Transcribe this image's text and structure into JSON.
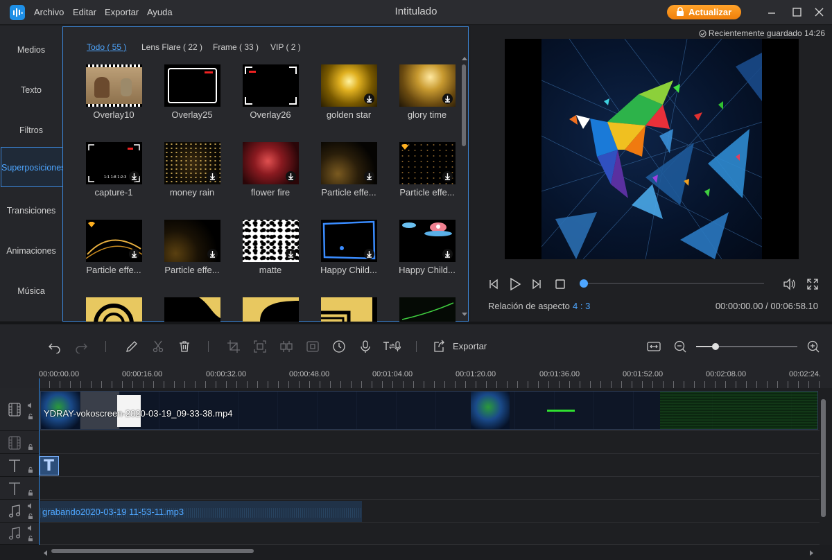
{
  "titlebar": {
    "menu": [
      "Archivo",
      "Editar",
      "Exportar",
      "Ayuda"
    ],
    "title": "Intitulado",
    "upgrade_label": "Actualizar"
  },
  "nav": {
    "items": [
      "Medios",
      "Texto",
      "Filtros",
      "Superposiciones",
      "Transiciones",
      "Animaciones",
      "Música"
    ],
    "active": "Superposiciones"
  },
  "media": {
    "tabs": [
      "Todo ( 55 )",
      "Lens Flare ( 22 )",
      "Frame ( 33 )",
      "VIP ( 2 )"
    ],
    "active_tab": "Todo ( 55 )",
    "items": [
      {
        "label": "Overlay10",
        "downloadable": false
      },
      {
        "label": "Overlay25",
        "downloadable": false
      },
      {
        "label": "Overlay26",
        "downloadable": false
      },
      {
        "label": "golden star",
        "downloadable": true
      },
      {
        "label": "glory time",
        "downloadable": true
      },
      {
        "label": "capture-1",
        "downloadable": true
      },
      {
        "label": "money rain",
        "downloadable": true
      },
      {
        "label": "flower fire",
        "downloadable": true
      },
      {
        "label": "Particle effe...",
        "downloadable": true
      },
      {
        "label": "Particle effe...",
        "downloadable": true
      },
      {
        "label": "Particle effe...",
        "downloadable": true
      },
      {
        "label": "Particle effe...",
        "downloadable": true
      },
      {
        "label": "matte",
        "downloadable": true
      },
      {
        "label": "Happy Child...",
        "downloadable": true
      },
      {
        "label": "Happy Child...",
        "downloadable": true
      }
    ],
    "thumb_text": {
      "capture": "1:1 1:8 1:2:3"
    }
  },
  "preview": {
    "save_status": "Recientemente guardado 14:26",
    "aspect_label": "Relación de aspecto",
    "aspect_value": "4 : 3",
    "timecode": "00:00:00.00 / 00:06:58.10",
    "progress": 0.0
  },
  "toolbar": {
    "export_label": "Exportar",
    "zoom_level": 0.2
  },
  "ruler": {
    "labels": [
      "00:00:00.00",
      "00:00:16.00",
      "00:00:32.00",
      "00:00:48.00",
      "00:01:04.00",
      "00:01:20.00",
      "00:01:36.00",
      "00:01:52.00",
      "00:02:08.00",
      "00:02:24."
    ]
  },
  "tracks": {
    "video_clip": "YDRAY-vokoscreen-2020-03-19_09-33-38.mp4",
    "text_clip": "T",
    "audio_clip": "grabando2020-03-19 11-53-11.mp3"
  },
  "colors": {
    "accent": "#4ea6ff",
    "upgrade": "#f7941d",
    "background": "#1e1f22"
  }
}
